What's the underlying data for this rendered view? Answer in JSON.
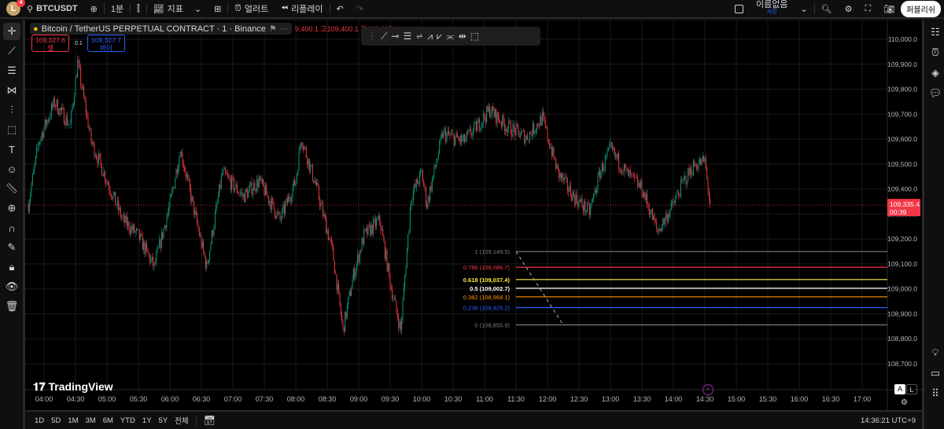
{
  "topbar": {
    "avatar": "L",
    "notifications": "4",
    "symbol": "BTCUSDT",
    "interval": "1분",
    "indicators": "지표",
    "alert": "얼러트",
    "replay": "리플레이",
    "layout_name": "이름없음",
    "layout_status": "저장",
    "publish": "퍼블리쉬"
  },
  "legend": {
    "title": "Bitcoin / TetherUS PERPETUAL CONTRACT · 1 · Binance",
    "ohlc": "9,400.1 고109,400.1 저109,335.4",
    "sell_price": "109,327.6",
    "sell_label": "셀",
    "spread": "0.1",
    "buy_price": "109,327.7",
    "buy_label": "바이"
  },
  "colors": {
    "up": "#089981",
    "down": "#f23645",
    "background": "#000000",
    "grid": "#1a1a1a",
    "price_tag": "#f23645"
  },
  "price_tag": {
    "price": "109,335.4",
    "countdown": "00:39"
  },
  "bottom": {
    "ranges": [
      "1D",
      "5D",
      "1M",
      "3M",
      "6M",
      "YTD",
      "1Y",
      "5Y",
      "전체"
    ],
    "clock": "14:36:21 UTC+9",
    "auto": "A",
    "log": "L"
  },
  "logo": "TradingView",
  "chart_data": {
    "type": "candlestick",
    "interval": "1 minute",
    "x_ticks": [
      "04:00",
      "04:30",
      "05:00",
      "05:30",
      "06:00",
      "06:30",
      "07:00",
      "07:30",
      "08:00",
      "08:30",
      "09:00",
      "09:30",
      "10:00",
      "10:30",
      "11:00",
      "11:30",
      "12:00",
      "12:30",
      "13:00",
      "13:30",
      "14:00",
      "14:30",
      "15:00",
      "15:30",
      "16:00",
      "16:30",
      "17:00"
    ],
    "y_ticks": [
      "110,000.0",
      "109,900.0",
      "109,800.0",
      "109,700.0",
      "109,600.0",
      "109,500.0",
      "109,400.0",
      "109,300.0",
      "109,200.0",
      "109,100.0",
      "109,000.0",
      "108,900.0",
      "108,800.0",
      "108,700.0"
    ],
    "ylim": [
      108680,
      110030
    ],
    "last_price": 109335.4,
    "close_path": [
      [
        "03:45",
        109339
      ],
      [
        "03:55",
        109591
      ],
      [
        "04:10",
        109748
      ],
      [
        "04:25",
        109654
      ],
      [
        "04:32",
        109906
      ],
      [
        "04:45",
        109591
      ],
      [
        "05:00",
        109433
      ],
      [
        "05:15",
        109276
      ],
      [
        "05:30",
        109213
      ],
      [
        "05:45",
        109087
      ],
      [
        "06:00",
        109339
      ],
      [
        "06:10",
        109559
      ],
      [
        "06:25",
        109276
      ],
      [
        "06:35",
        109087
      ],
      [
        "06:50",
        109465
      ],
      [
        "07:10",
        109370
      ],
      [
        "07:25",
        109433
      ],
      [
        "07:45",
        109276
      ],
      [
        "08:00",
        109433
      ],
      [
        "08:05",
        109607
      ],
      [
        "08:20",
        109402
      ],
      [
        "08:35",
        109150
      ],
      [
        "08:45",
        108835
      ],
      [
        "08:55",
        109056
      ],
      [
        "09:05",
        109213
      ],
      [
        "09:20",
        109276
      ],
      [
        "09:30",
        109024
      ],
      [
        "09:40",
        108835
      ],
      [
        "09:50",
        109370
      ],
      [
        "10:00",
        109465
      ],
      [
        "10:05",
        109339
      ],
      [
        "10:20",
        109622
      ],
      [
        "10:40",
        109591
      ],
      [
        "10:50",
        109638
      ],
      [
        "11:05",
        109717
      ],
      [
        "11:20",
        109654
      ],
      [
        "11:40",
        109607
      ],
      [
        "11:55",
        109685
      ],
      [
        "12:10",
        109465
      ],
      [
        "12:25",
        109370
      ],
      [
        "12:40",
        109307
      ],
      [
        "12:50",
        109465
      ],
      [
        "13:00",
        109559
      ],
      [
        "13:15",
        109465
      ],
      [
        "13:30",
        109402
      ],
      [
        "13:45",
        109229
      ],
      [
        "14:00",
        109339
      ],
      [
        "14:10",
        109433
      ],
      [
        "14:20",
        109496
      ],
      [
        "14:30",
        109512
      ],
      [
        "14:35",
        109335
      ]
    ],
    "fibonacci": {
      "start_time": "11:30",
      "end_time": "12:00",
      "levels": [
        {
          "ratio": "1",
          "price": 109149.5,
          "label": "1 (109,149.5)",
          "color": "#787b86"
        },
        {
          "ratio": "0.786",
          "price": 109086.7,
          "label": "0.786 (109,086.7)",
          "color": "#f23645"
        },
        {
          "ratio": "0.618",
          "price": 109037.4,
          "label": "0.618 (109,037.4)",
          "color": "#ffeb3b"
        },
        {
          "ratio": "0.5",
          "price": 109002.7,
          "label": "0.5 (109,002.7)",
          "color": "#ffffff"
        },
        {
          "ratio": "0.382",
          "price": 108968.1,
          "label": "0.382 (108,968.1)",
          "color": "#ff9800"
        },
        {
          "ratio": "0.236",
          "price": 108925.2,
          "label": "0.236 (108,925.2)",
          "color": "#2962ff"
        },
        {
          "ratio": "0",
          "price": 108855.9,
          "label": "0 (108,855.9)",
          "color": "#787b86"
        }
      ]
    }
  }
}
